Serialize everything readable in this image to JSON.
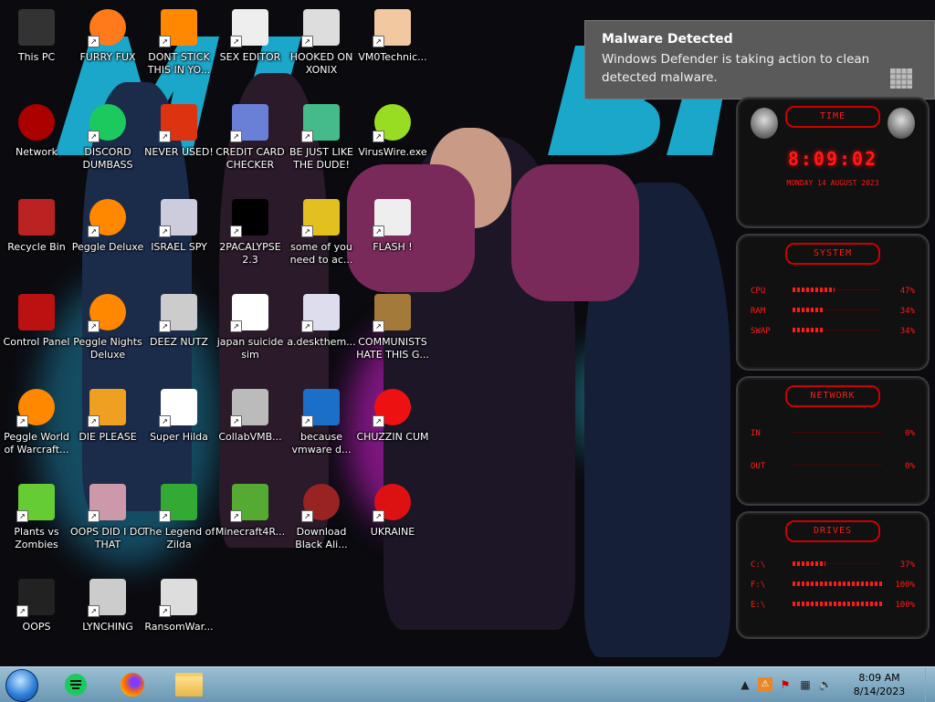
{
  "desktop": {
    "icons": [
      {
        "label": "This PC",
        "icon": "computer-icon"
      },
      {
        "label": "FURRY FUX",
        "icon": "firefox-icon"
      },
      {
        "label": "DONT STICK THIS IN YO...",
        "icon": "vlc-cone-icon"
      },
      {
        "label": "SEX EDITOR",
        "icon": "hxd-icon"
      },
      {
        "label": "HOOKED ON XONIX",
        "icon": "xonix-icon"
      },
      {
        "label": "VM0Technic...",
        "icon": "doctor-icon"
      },
      {
        "label": "Network",
        "icon": "alien-network-icon"
      },
      {
        "label": "DISCORD DUMBASS",
        "icon": "chat-icon"
      },
      {
        "label": "NEVER USED!",
        "icon": "dev-cpp-icon"
      },
      {
        "label": "CREDIT CARD CHECKER",
        "icon": "credit-card-icon"
      },
      {
        "label": "BE JUST LIKE THE DUDE!",
        "icon": "santa-icon"
      },
      {
        "label": "VirusWire.exe",
        "icon": "lime-icon"
      },
      {
        "label": "Recycle Bin",
        "icon": "recycle-bin-icon"
      },
      {
        "label": "Peggle Deluxe",
        "icon": "peggle-icon"
      },
      {
        "label": "ISRAEL SPY",
        "icon": "spy-icon"
      },
      {
        "label": "2PACALYPSE 2.3",
        "icon": "terminal-icon"
      },
      {
        "label": "some of you need to ac...",
        "icon": "dog-icon"
      },
      {
        "label": "FLASH !",
        "icon": "flash-icon"
      },
      {
        "label": "Control Panel",
        "icon": "control-panel-icon"
      },
      {
        "label": "Peggle Nights Deluxe",
        "icon": "peggle-icon"
      },
      {
        "label": "DEEZ NUTZ",
        "icon": "windows-stack-icon"
      },
      {
        "label": "japan suicide sim",
        "icon": "document-icon"
      },
      {
        "label": "a.deskthem...",
        "icon": "theme-icon"
      },
      {
        "label": "COMMUNISTS HATE THIS G...",
        "icon": "money-bag-icon"
      },
      {
        "label": "Peggle World of Warcraft...",
        "icon": "peggle-icon"
      },
      {
        "label": "DIE PLEASE",
        "icon": "de-icon"
      },
      {
        "label": "Super Hilda",
        "icon": "pixel-icon"
      },
      {
        "label": "CollabVMB...",
        "icon": "monitor-icon"
      },
      {
        "label": "because vmware d...",
        "icon": "virtualbox-icon"
      },
      {
        "label": "CHUZZIN CUM",
        "icon": "chuzzle-icon"
      },
      {
        "label": "Plants vs Zombies",
        "icon": "plant-icon"
      },
      {
        "label": "OOPS DID I DO THAT",
        "icon": "portrait-icon"
      },
      {
        "label": "The Legend of Zilda",
        "icon": "zelda-icon"
      },
      {
        "label": "Minecraft4R...",
        "icon": "minecraft-icon"
      },
      {
        "label": "Download Black Ali...",
        "icon": "alien-icon"
      },
      {
        "label": "UKRAINE",
        "icon": "radiation-icon"
      },
      {
        "label": "OOPS",
        "icon": "dark-icon"
      },
      {
        "label": "LYNCHING",
        "icon": "gear-icon"
      },
      {
        "label": "RansomWar...",
        "icon": "skull-icon"
      }
    ]
  },
  "notification": {
    "title": "Malware Detected",
    "body": "Windows Defender is taking action to clean detected malware."
  },
  "gadget": {
    "time_header": "TIME",
    "time": "8:09:02",
    "date": "MONDAY 14 AUGUST 2023",
    "system_header": "SYSTEM",
    "system": [
      {
        "key": "CPU",
        "value": "47%",
        "fill": 0.47
      },
      {
        "key": "RAM",
        "value": "34%",
        "fill": 0.34
      },
      {
        "key": "SWAP",
        "value": "34%",
        "fill": 0.34
      }
    ],
    "network_header": "NETWORK",
    "network": [
      {
        "key": "IN",
        "value": "0%"
      },
      {
        "key": "OUT",
        "value": "0%"
      }
    ],
    "drives_header": "DRIVES",
    "drives": [
      {
        "key": "C:\\",
        "value": "37%",
        "fill": 0.37
      },
      {
        "key": "F:\\",
        "value": "100%",
        "fill": 1.0
      },
      {
        "key": "E:\\",
        "value": "100%",
        "fill": 1.0
      }
    ]
  },
  "taskbar": {
    "pinned": [
      "chat-icon",
      "firefox-icon",
      "folder-icon"
    ],
    "clock_time": "8:09 AM",
    "clock_date": "8/14/2023"
  }
}
